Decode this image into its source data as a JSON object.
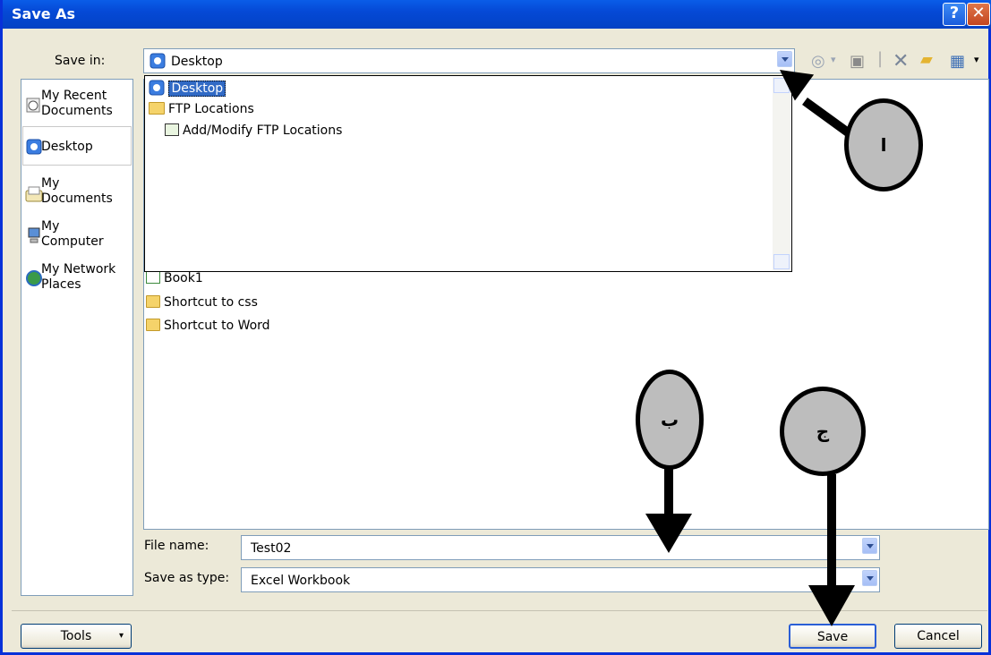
{
  "title": "Save As",
  "title_buttons": {
    "help": "?",
    "close": "✕"
  },
  "save_in": {
    "label": "Save in:",
    "value": "Desktop"
  },
  "places": [
    {
      "label": "My Recent\nDocuments",
      "icon": "recent-documents-icon"
    },
    {
      "label": "Desktop",
      "icon": "desktop-icon"
    },
    {
      "label": "My\nDocuments",
      "icon": "my-documents-icon"
    },
    {
      "label": "My\nComputer",
      "icon": "my-computer-icon"
    },
    {
      "label": "My Network\nPlaces",
      "icon": "network-places-icon"
    }
  ],
  "dropdown_items": [
    {
      "label": "Desktop",
      "selected": true,
      "icon": "desktop-icon"
    },
    {
      "label": "FTP Locations",
      "icon": "folder-icon"
    },
    {
      "label": "Add/Modify FTP Locations",
      "icon": "ftp-add-icon"
    }
  ],
  "files": [
    {
      "label": "Book1",
      "icon": "excel-file-icon"
    },
    {
      "label": "Shortcut to css",
      "icon": "folder-shortcut-icon"
    },
    {
      "label": "Shortcut to Word",
      "icon": "folder-shortcut-icon"
    }
  ],
  "file_name": {
    "label": "File name:",
    "value": "Test02"
  },
  "save_as_type": {
    "label": "Save as type:",
    "value": "Excel Workbook"
  },
  "buttons": {
    "tools": "Tools",
    "save": "Save",
    "cancel": "Cancel"
  },
  "callouts": {
    "a": "ا",
    "b": "ب",
    "c": "ج"
  },
  "colors": {
    "titlebar": "#0549d6",
    "dialog_bg": "#ece9d8",
    "selection": "#316ac5"
  }
}
